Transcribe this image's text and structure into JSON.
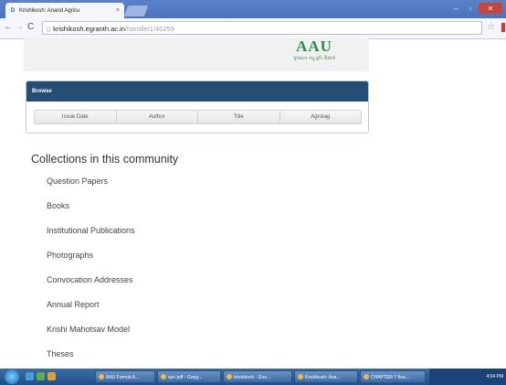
{
  "browser": {
    "tab_title": "Krishikosh: Anand Agricu",
    "tab_close": "×",
    "favicon": "D",
    "url_host": "krishikosh.egranth.ac.in",
    "url_path": "/handle/1/46259",
    "back_glyph": "←",
    "forward_glyph": "→",
    "reload_glyph": "C",
    "star_glyph": "☆",
    "win_min": "–",
    "win_max": "▫",
    "win_close": "✕"
  },
  "header": {
    "logo_text": "AAU",
    "logo_subtext": "ગુજરાત ન્યૂ કૃષિ વિદ્યાલ"
  },
  "browse": {
    "title": "Browse",
    "buttons": [
      "Issue Date",
      "Author",
      "Title",
      "Agrotag"
    ]
  },
  "collections": {
    "title": "Collections in this community",
    "items": [
      "Question Papers",
      "Books",
      "Institutional Publications",
      "Photographs",
      "Convocation Addresses",
      "Annual Report",
      "Krishi Mahotsav Model",
      "Theses"
    ]
  },
  "taskbar": {
    "tasks": [
      "AAU Format A...",
      "spe pdf - Goog...",
      "krishikosh - Goo...",
      "Krishikosh: Ana...",
      "CHAPTER-7 fina..."
    ],
    "clock": "4:04 PM"
  }
}
